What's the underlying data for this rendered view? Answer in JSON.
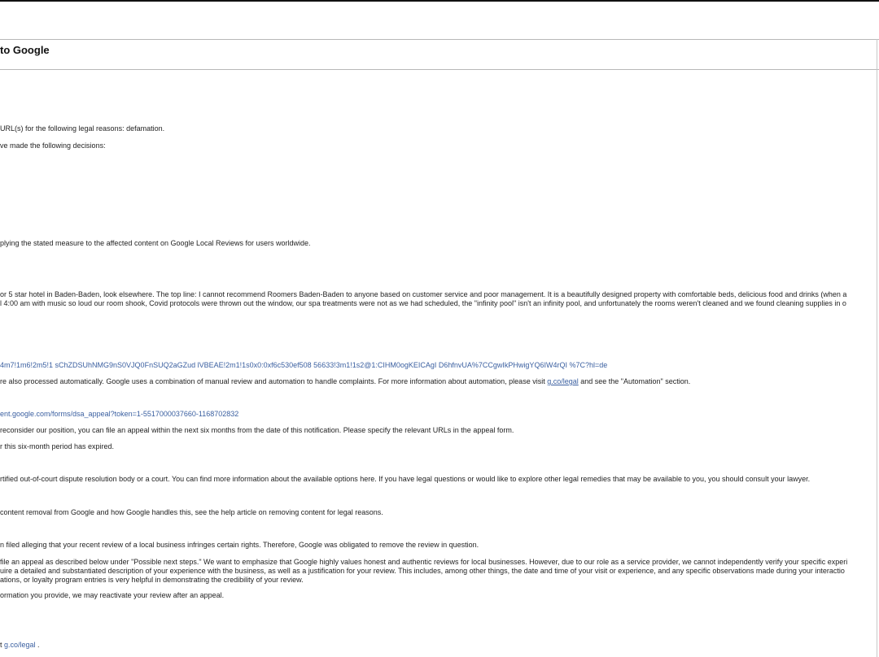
{
  "header": {
    "title": "to Google"
  },
  "body": {
    "p01": "URL(s) for the following legal reasons: defamation.",
    "p02": "ve made the following decisions:",
    "p03": "plying the stated measure to the affected content on Google Local Reviews for users worldwide.",
    "p04": "or 5 star hotel in Baden-Baden, look elsewhere. The top line: I cannot recommend Roomers Baden-Baden to anyone based on customer service and poor management. It is a beautifully designed property with comfortable beds, delicious food and drinks (when a",
    "p05": "l 4:00 am with music so loud our room shook, Covid protocols were thrown out the window, our spa treatments were not as we had scheduled, the \"infinity pool\" isn't an infinity pool, and unfortunately the rooms weren't cleaned and we found cleaning supplies in o",
    "p06_link": "4m7!1m6!2m5!1 sChZDSUhNMG9nS0VJQ0FnSUQ2aGZud lVBEAE!2m1!1s0x0:0xf6c530ef508 56633!3m1!1s2@1:CIHM0ogKEICAgI D6hfnvUA%7CCgwIkPHwigYQ6IW4rQI %7C?hl=de",
    "p07_before": "re also processed automatically. Google uses a combination of manual review and automation to handle complaints. For more information about automation, please visit ",
    "p07_link": "g.co/legal",
    "p07_after": " and see the \"Automation\" section.",
    "p08_link": "ent.google.com/forms/dsa_appeal?token=1-5517000037660-1168702832",
    "p09": "reconsider our position, you can file an appeal within the next six months from the date of this notification. Please specify the relevant URLs in the appeal form.",
    "p10": "r this six-month period has expired.",
    "p11": "rtified out-of-court dispute resolution body or a court. You can find more information about the available options here. If you have legal questions or would like to explore other legal remedies that may be available to you, you should consult your lawyer.",
    "p12": "content removal from Google and how Google handles this, see the help article on removing content for legal reasons.",
    "p13": "n filed alleging that your recent review of a local business infringes certain rights. Therefore, Google was obligated to remove the review in question.",
    "p14": "file an appeal as described below under \"Possible next steps.\" We want to emphasize that Google highly values honest and authentic reviews for local businesses. However, due to our role as a service provider, we cannot independently verify your specific experi",
    "p15": "uire a detailed and substantiated description of your experience with the business, as well as a justification for your review. This includes, among other things, the date and time of your visit or experience, and any specific observations made during your interactio",
    "p16": "ations, or loyalty program entries is very helpful in demonstrating the credibility of your review.",
    "p17": "ormation you provide, we may reactivate your review after an appeal.",
    "p18_before": "t ",
    "p18_link": "g.co/legal",
    "p18_after": " ."
  }
}
